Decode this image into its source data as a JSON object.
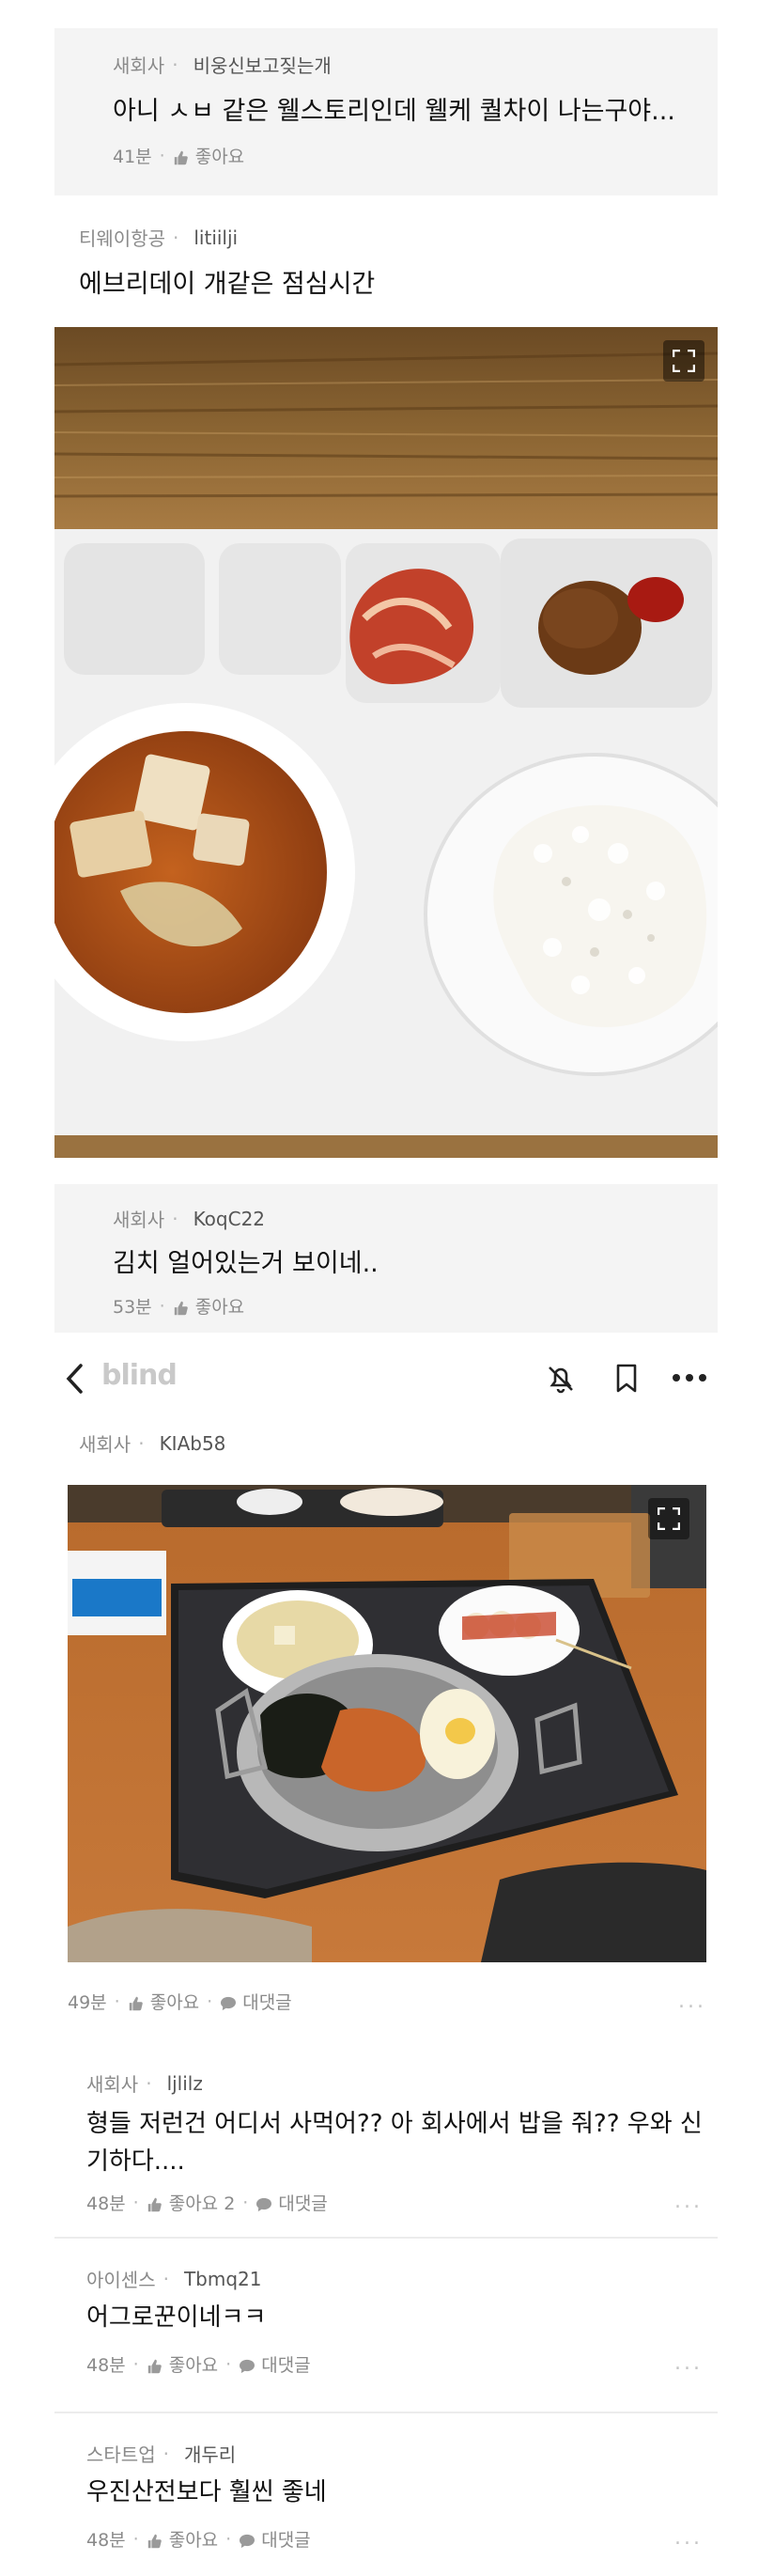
{
  "reply1": {
    "company": "새회사",
    "user": "비웅신보고짖는개",
    "text": "아니 ㅅㅂ 같은 웰스토리인데 웰케 퀄차이 나는구야...",
    "time": "41분",
    "like": "좋아요"
  },
  "post": {
    "company": "티웨이항공",
    "user": "litiilji",
    "title": "에브리데이 개같은 점심시간"
  },
  "reply2": {
    "company": "새회사",
    "user": "KoqC22",
    "text": "김치 얼어있는거 보이네..",
    "time": "53분",
    "like": "좋아요"
  },
  "header": {
    "logo": "blind"
  },
  "post2": {
    "company": "새회사",
    "user": "KIAb58",
    "time": "49분",
    "like": "좋아요",
    "reply": "대댓글",
    "more": "..."
  },
  "comments": [
    {
      "company": "새회사",
      "user": "ljlilz",
      "text": "형들 저런건 어디서 사먹어?? 아 회사에서 밥을 줘?? 우와 신기하다....",
      "time": "48분",
      "like": "좋아요 2",
      "reply": "대댓글",
      "more": "..."
    },
    {
      "company": "아이센스",
      "user": "Tbmq21",
      "text": "어그로꾼이네ㅋㅋ",
      "time": "48분",
      "like": "좋아요",
      "reply": "대댓글",
      "more": "..."
    },
    {
      "company": "스타트업",
      "user": "개두리",
      "text": "우진산전보다 훨씬 좋네",
      "time": "48분",
      "like": "좋아요",
      "reply": "대댓글",
      "more": "..."
    }
  ],
  "colors": {
    "accent": "#111111",
    "muted": "#8a8a8a",
    "card": "#f4f4f4"
  }
}
